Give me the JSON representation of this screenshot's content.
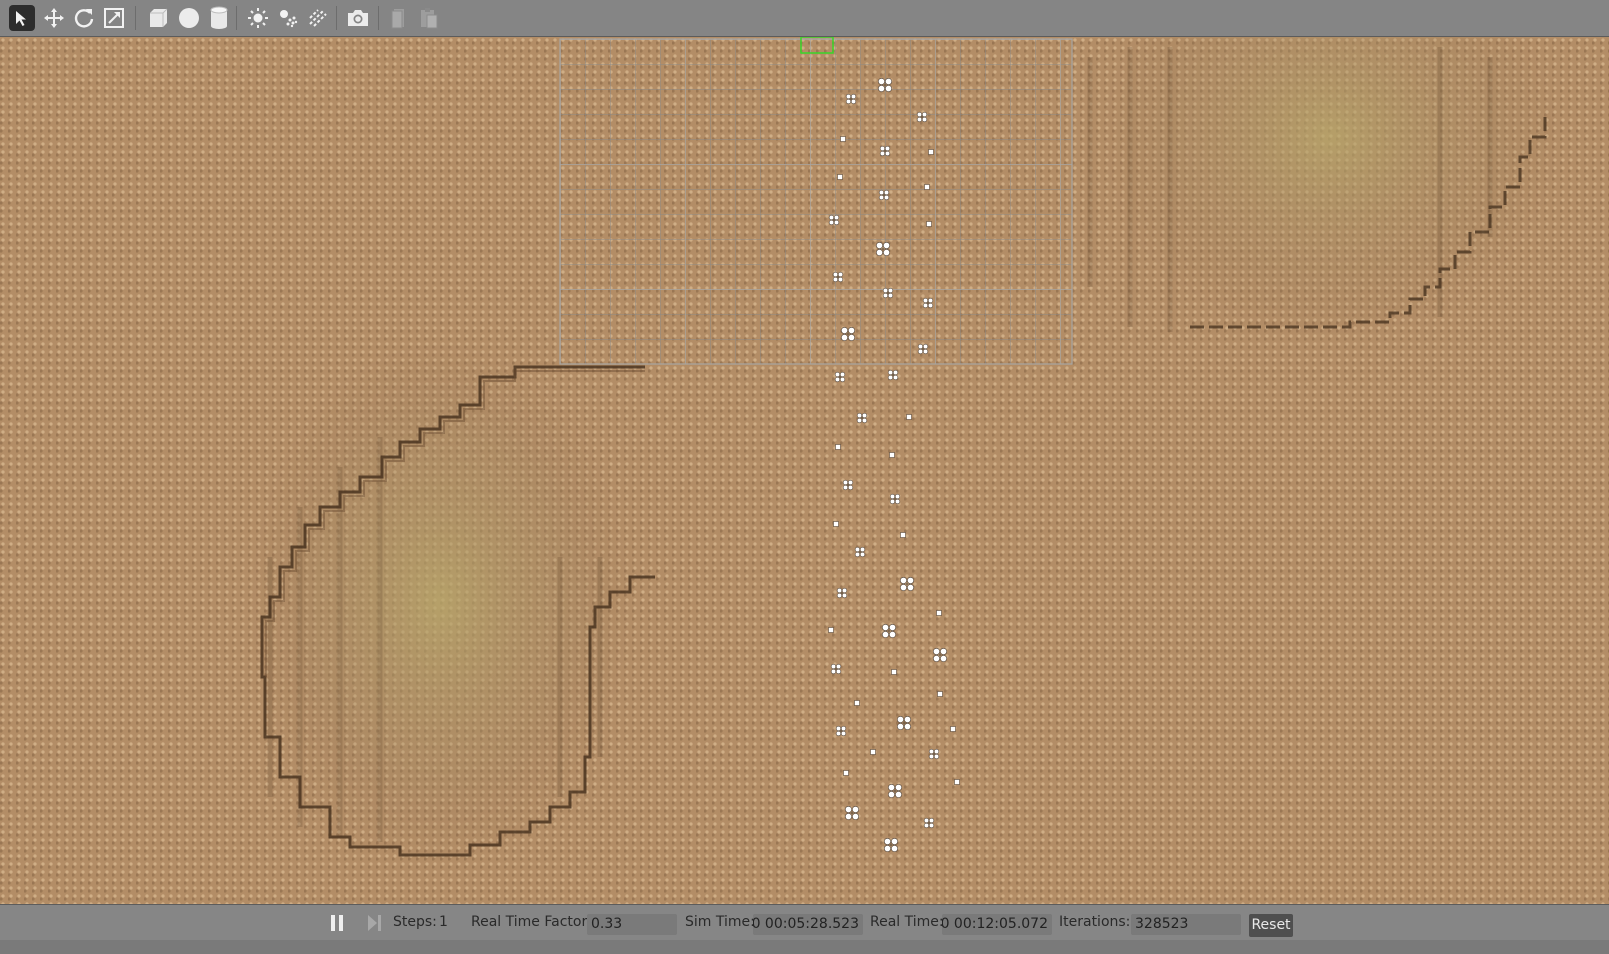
{
  "toolbar": {
    "tools": [
      {
        "name": "select-mode-icon",
        "active": true
      },
      {
        "name": "translate-mode-icon",
        "active": false
      },
      {
        "name": "rotate-mode-icon",
        "active": false
      },
      {
        "name": "scale-mode-icon",
        "active": false
      },
      {
        "name": "box-shape-icon",
        "active": false
      },
      {
        "name": "sphere-shape-icon",
        "active": false
      },
      {
        "name": "cylinder-shape-icon",
        "active": false
      },
      {
        "name": "point-light-icon",
        "active": false
      },
      {
        "name": "spot-light-icon",
        "active": false
      },
      {
        "name": "directional-light-icon",
        "active": false
      },
      {
        "name": "screenshot-camera-icon",
        "active": false
      },
      {
        "name": "copy-icon",
        "active": false
      },
      {
        "name": "paste-icon",
        "active": false
      }
    ]
  },
  "status": {
    "steps_label": "Steps:",
    "steps_value": "1",
    "rtf_label": "Real Time Factor:",
    "rtf_value": "0.33",
    "sim_time_label": "Sim Time:",
    "sim_time_value": "00 00:05:28.523",
    "real_time_label": "Real Time:",
    "real_time_value": "00 00:12:05.072",
    "iterations_label": "Iterations:",
    "iterations_value": "328523",
    "reset_label": "Reset",
    "play_state": "paused"
  },
  "colors": {
    "toolbar_bg": "#858585",
    "ground": "#b38d66",
    "grid_line": "#8f8f8f",
    "selection_box": "#39d629",
    "plant": "#ffffff"
  }
}
